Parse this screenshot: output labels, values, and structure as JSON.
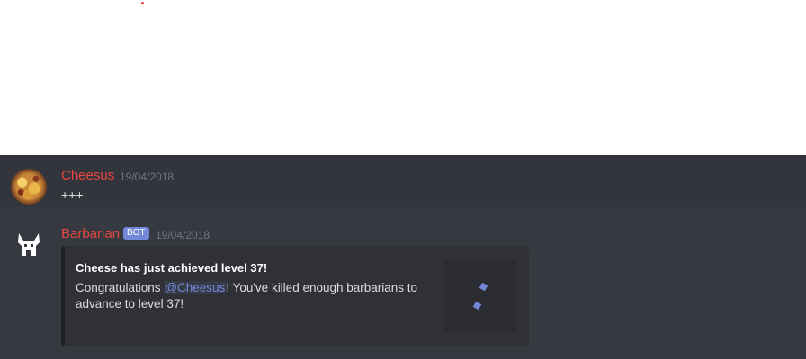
{
  "messages": [
    {
      "username": "Cheesus",
      "timestamp": "19/04/2018",
      "text": "+++",
      "avatar": "cheese-pizza-avatar"
    },
    {
      "username": "Barbarian",
      "badge": "BOT",
      "timestamp": "19/04/2018",
      "avatar": "barbarian-helmet-icon",
      "embed": {
        "title": "Cheese has just achieved level 37!",
        "desc_before": "Congratulations ",
        "mention": "@Cheesus",
        "desc_after": "! You've killed enough barbarians to advance to level 37!",
        "thumbnail": "confetti-icon"
      }
    }
  ],
  "colors": {
    "background": "#36393f",
    "username": "#e9473f",
    "bot_badge": "#7289da",
    "mention": "#7289da",
    "embed_bg": "#2f3136"
  }
}
